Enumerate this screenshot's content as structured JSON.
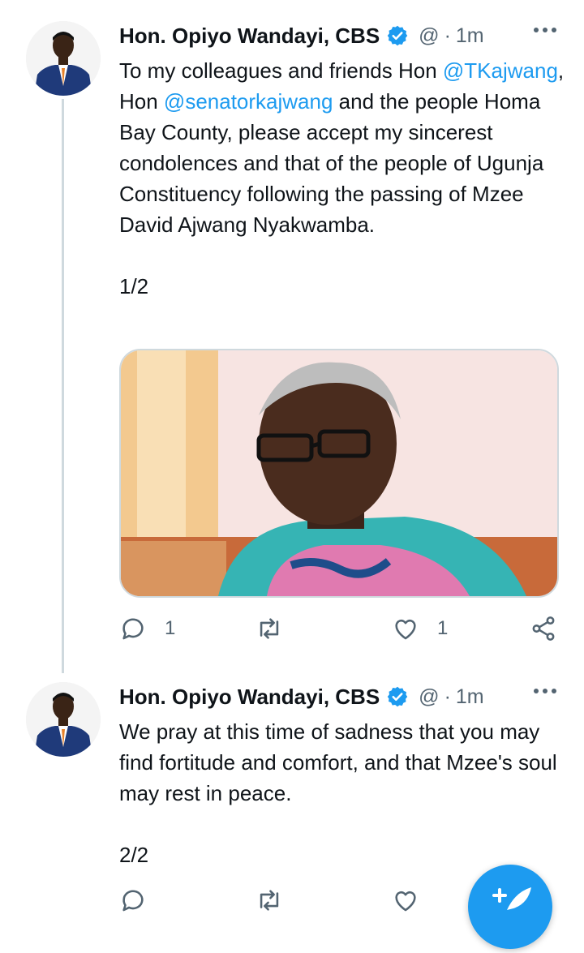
{
  "colors": {
    "link": "#1d9bf0",
    "muted": "#536471",
    "verified": "#1d9bf0",
    "thread_line": "#cfd9de"
  },
  "tweets": [
    {
      "author": "Hon. Opiyo Wandayi, CBS",
      "handle": "@",
      "dot": "·",
      "time": "1m",
      "text": {
        "t1": "To my colleagues and friends Hon ",
        "mention1": "@TKajwang",
        "t2": ", Hon ",
        "mention2": "@senatorkajwang",
        "t3": " and the people Homa Bay County, please accept my sincerest condolences and that of the people of Ugunja Constituency following the passing of Mzee David Ajwang Nyakwamba.",
        "counter": "1/2"
      },
      "actions": {
        "replies": "1",
        "likes": "1"
      }
    },
    {
      "author": "Hon. Opiyo Wandayi, CBS",
      "handle": "@",
      "dot": "·",
      "time": "1m",
      "text": {
        "body": "We pray at this time of sadness that you may find fortitude and comfort, and that Mzee's soul may rest in peace.",
        "counter": "2/2"
      }
    }
  ],
  "icons": [
    "verified-badge-icon",
    "more-icon",
    "reply-icon",
    "retweet-icon",
    "like-icon",
    "share-icon",
    "compose-tweet-icon"
  ]
}
